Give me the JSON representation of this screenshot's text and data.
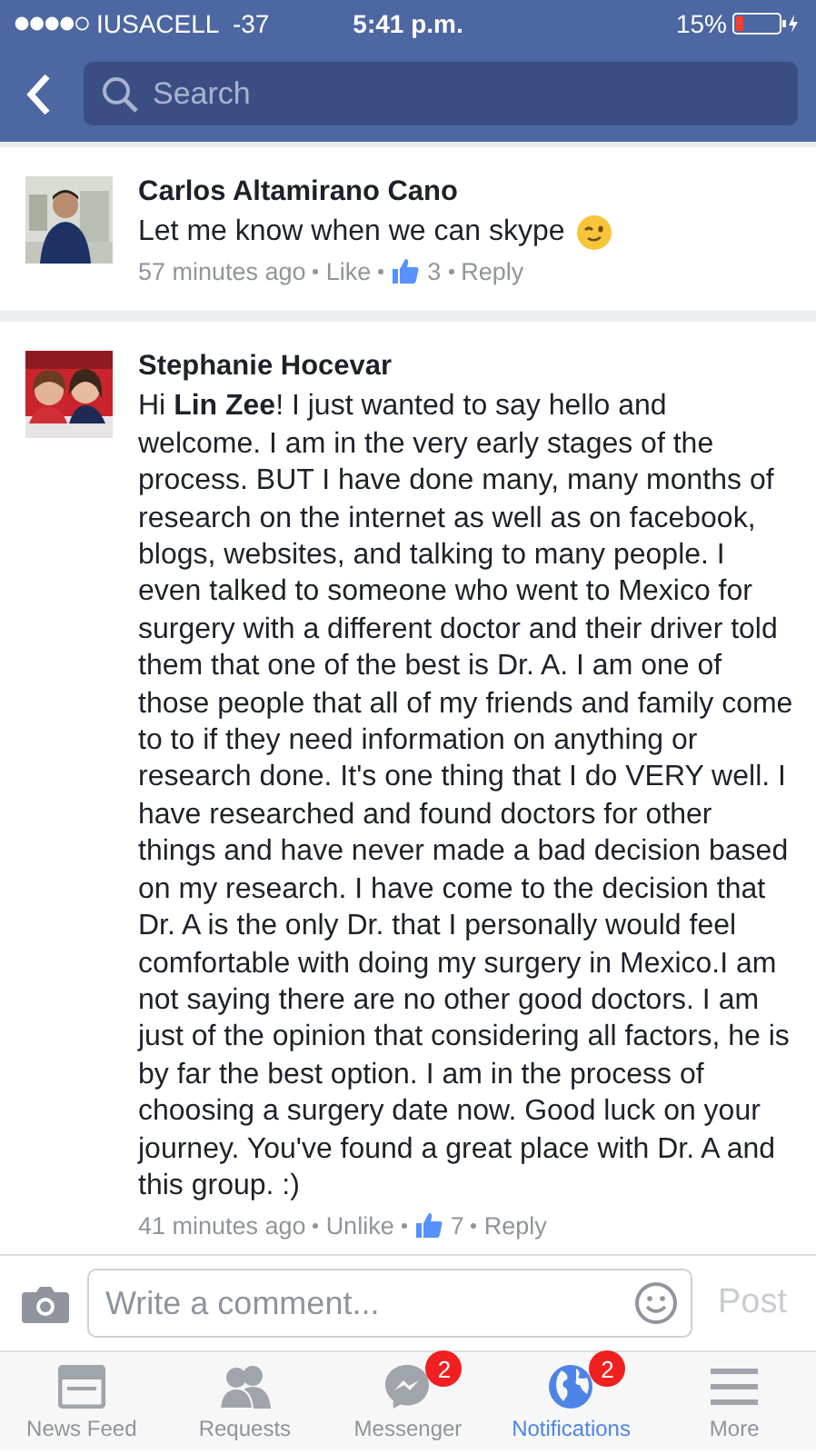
{
  "status_bar": {
    "carrier": "IUSACELL  -37",
    "time": "5:41 p.m.",
    "battery": "15%"
  },
  "nav": {
    "search": {
      "placeholder": "Search"
    }
  },
  "comments": [
    {
      "author": "Carlos Altamirano Cano",
      "text": "Let me know when we can skype",
      "wink_emoji": true,
      "time": "57 minutes ago",
      "like": "Like",
      "likes": "3",
      "reply": "Reply"
    },
    {
      "author": "Stephanie Hocevar",
      "text": "Hi **Lin Zee**! I just wanted to say hello and welcome. I am in the very early stages of the process. BUT I have done many, many months of research on the internet as well as on facebook, blogs, websites, and talking to many people. I even talked to someone who went to Mexico for surgery with a different doctor and their driver told them that one of the best is Dr. A. I am one of those people that all of my friends and family come to to if they need information on anything or research done. It's one thing that I do VERY well. I have researched and found doctors for other things and have never made a bad decision based on my research. I have come to the decision that Dr. A is the only Dr. that I personally would feel comfortable with doing my surgery in Mexico.I am not saying there are no other good doctors. I am just of the opinion that considering all factors, he is by far the best option. I am in the process of choosing a surgery date now. Good luck on your journey. You've found a great place with Dr. A and this group. :)",
      "time": "41 minutes ago",
      "like": "Unlike",
      "likes": "7",
      "reply": "Reply"
    }
  ],
  "composer": {
    "placeholder": "Write a comment...",
    "post": "Post",
    "disabled": true
  },
  "tabs": [
    {
      "label": "News Feed",
      "kind": "feed",
      "selected": false
    },
    {
      "label": "Requests",
      "kind": "requests",
      "selected": false
    },
    {
      "label": "Messenger",
      "kind": "messenger",
      "selected": false,
      "badge": "2"
    },
    {
      "label": "Notifications",
      "kind": "globe",
      "selected": true,
      "badge": "2"
    },
    {
      "label": "More",
      "kind": "more",
      "selected": false
    }
  ]
}
